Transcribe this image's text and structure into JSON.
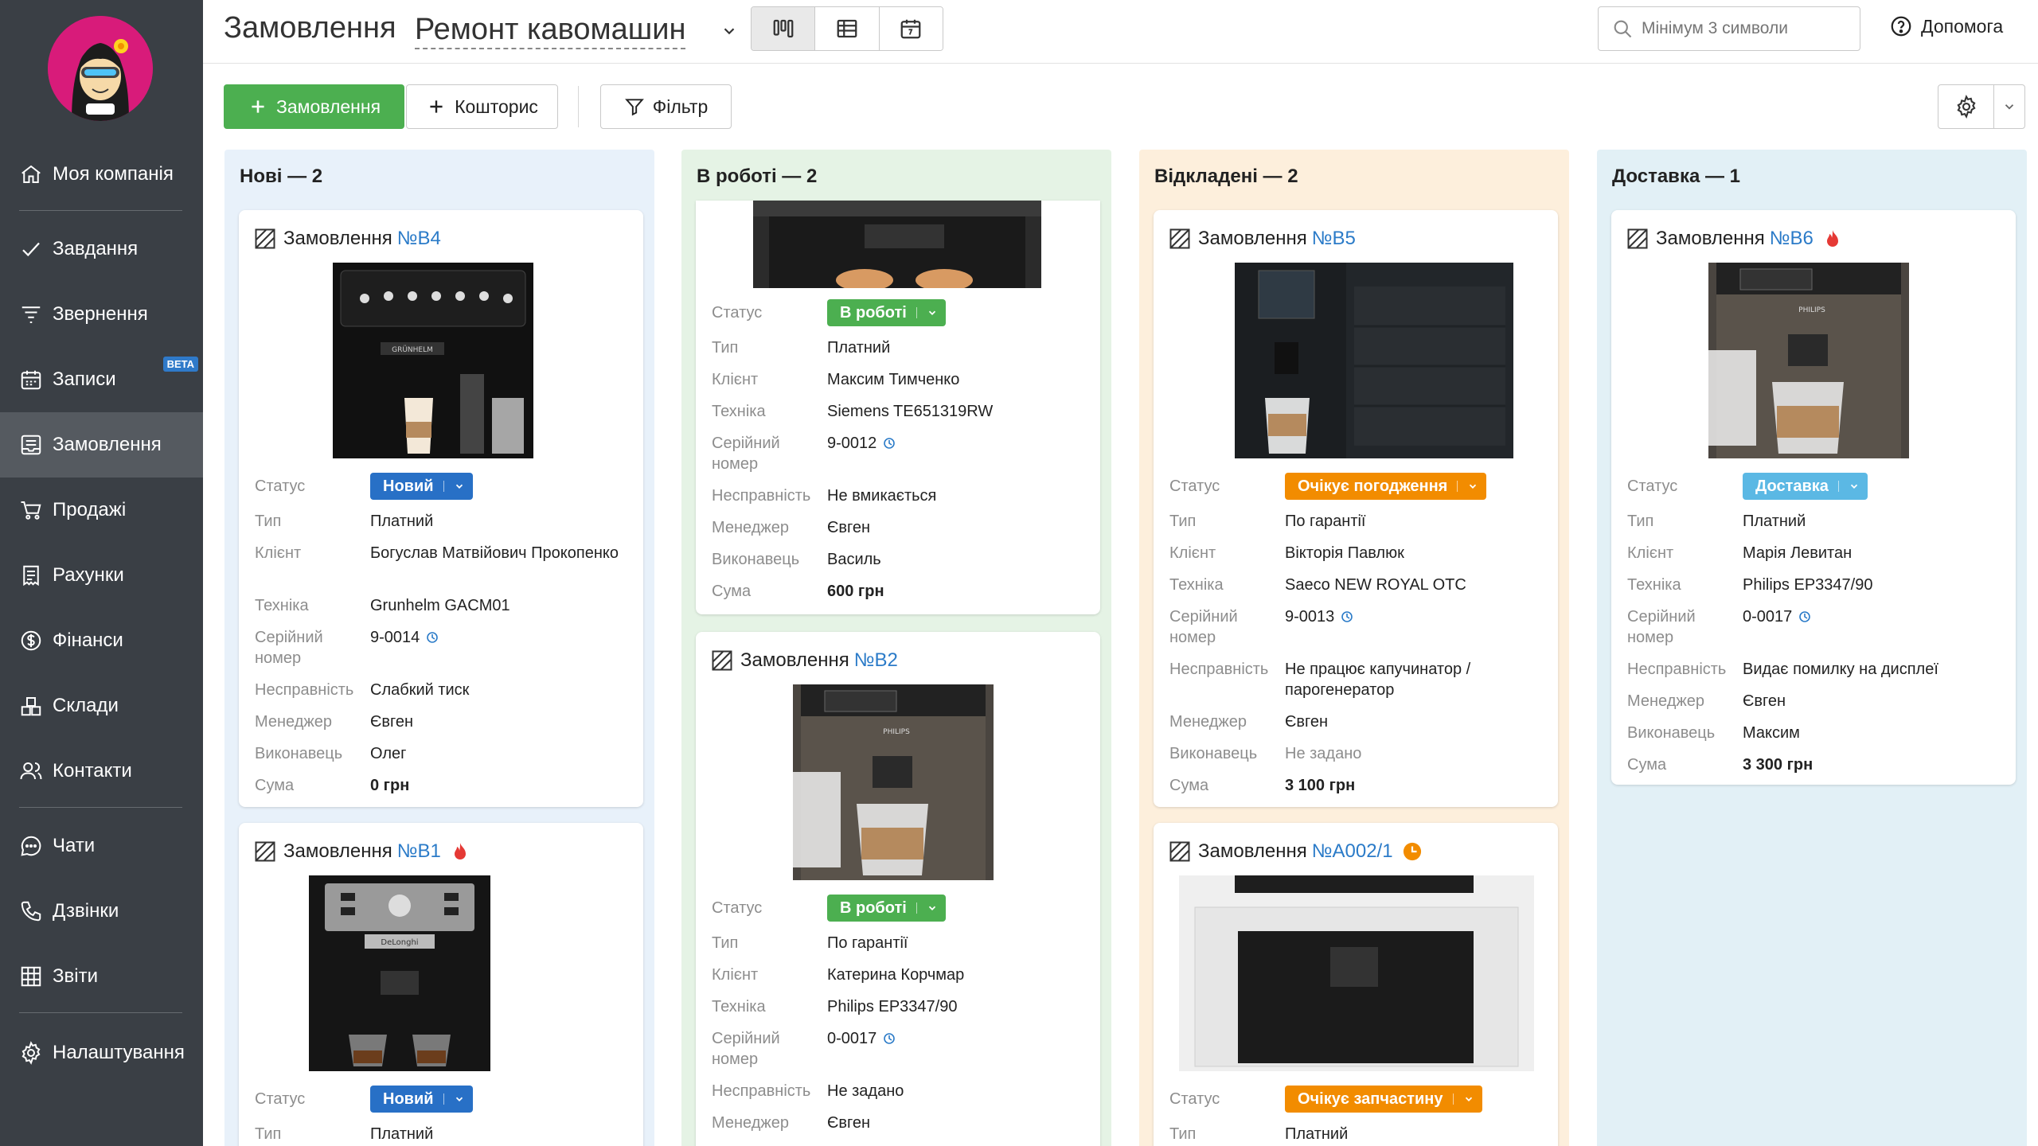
{
  "colors": {
    "sidebar": "#3a3f45",
    "accent_green": "#4caf50",
    "link_blue": "#2b7bc8",
    "status_new": "#2870c6",
    "status_work": "#4caf50",
    "status_wait": "#f28c00",
    "status_delivery": "#5bb8e4"
  },
  "nav": [
    {
      "label": "Моя компанія",
      "icon": "home-icon"
    },
    {
      "label": "Завдання",
      "icon": "check-icon"
    },
    {
      "label": "Звернення",
      "icon": "funnel-icon"
    },
    {
      "label": "Записи",
      "icon": "calendar-icon",
      "badge": "BETA"
    },
    {
      "label": "Замовлення",
      "icon": "orders-icon"
    },
    {
      "label": "Продажі",
      "icon": "cart-icon"
    },
    {
      "label": "Рахунки",
      "icon": "invoice-icon"
    },
    {
      "label": "Фінанси",
      "icon": "dollar-icon"
    },
    {
      "label": "Склади",
      "icon": "boxes-icon"
    },
    {
      "label": "Контакти",
      "icon": "contacts-icon"
    },
    {
      "label": "Чати",
      "icon": "chat-icon"
    },
    {
      "label": "Дзвінки",
      "icon": "phone-icon"
    },
    {
      "label": "Звіти",
      "icon": "reports-icon"
    },
    {
      "label": "Налаштування",
      "icon": "gear-icon"
    }
  ],
  "header": {
    "title": "Замовлення",
    "board": "Ремонт кавомашин",
    "search_placeholder": "Мінімум 3 символи",
    "help": "Допомога"
  },
  "toolbar": {
    "order": "Замовлення",
    "estimate": "Кошторис",
    "filter": "Фільтр"
  },
  "labels": {
    "status": "Статус",
    "type": "Тип",
    "client": "Клієнт",
    "device": "Техніка",
    "serial1": "Серійний",
    "serial2": "номер",
    "fault": "Несправність",
    "manager": "Менеджер",
    "executor": "Виконавець",
    "sum": "Сума",
    "order": "Замовлення"
  },
  "columns": [
    {
      "title": "Нові — 2"
    },
    {
      "title": "В роботі — 2"
    },
    {
      "title": "Відкладені — 2"
    },
    {
      "title": "Доставка — 1"
    }
  ],
  "cards": {
    "b4": {
      "num": "№В4",
      "status": "Новий",
      "type": "Платний",
      "client": "Богуслав Матвійович Прокопенко",
      "device": "Grunhelm GACM01",
      "serial": "9-0014",
      "fault": "Слабкий тиск",
      "manager": "Євген",
      "executor": "Олег",
      "sum": "0 грн",
      "brand": "GRÜNHELM"
    },
    "b1": {
      "num": "№В1",
      "status": "Новий",
      "type": "Платний",
      "brand": "DeLonghi"
    },
    "w1": {
      "status": "В роботі",
      "type": "Платний",
      "client": "Максим Тимченко",
      "device": "Siemens TE651319RW",
      "serial": "9-0012",
      "fault": "Не вмикається",
      "manager": "Євген",
      "executor": "Василь",
      "sum": "600 грн"
    },
    "b2": {
      "num": "№В2",
      "status": "В роботі",
      "type": "По гарантії",
      "client": "Катерина Корчмар",
      "device": "Philips EP3347/90",
      "serial": "0-0017",
      "fault": "Не задано",
      "manager": "Євген",
      "brand": "PHILIPS"
    },
    "b5": {
      "num": "№В5",
      "status": "Очікує погодження",
      "type": "По гарантії",
      "client": "Вікторія Павлюк",
      "device": "Saeco NEW ROYAL OTC",
      "serial": "9-0013",
      "fault": "Не працює капучинатор / парогенератор",
      "manager": "Євген",
      "executor": "Не задано",
      "sum": "3 100 грн"
    },
    "a002": {
      "num": "№А002/1",
      "status": "Очікує запчастину",
      "type": "Платний"
    },
    "b6": {
      "num": "№В6",
      "status": "Доставка",
      "type": "Платний",
      "client": "Марія Левитан",
      "device": "Philips EP3347/90",
      "serial": "0-0017",
      "fault": "Видає помилку на дисплеї",
      "manager": "Євген",
      "executor": "Максим",
      "sum": "3 300 грн",
      "brand": "PHILIPS"
    }
  }
}
